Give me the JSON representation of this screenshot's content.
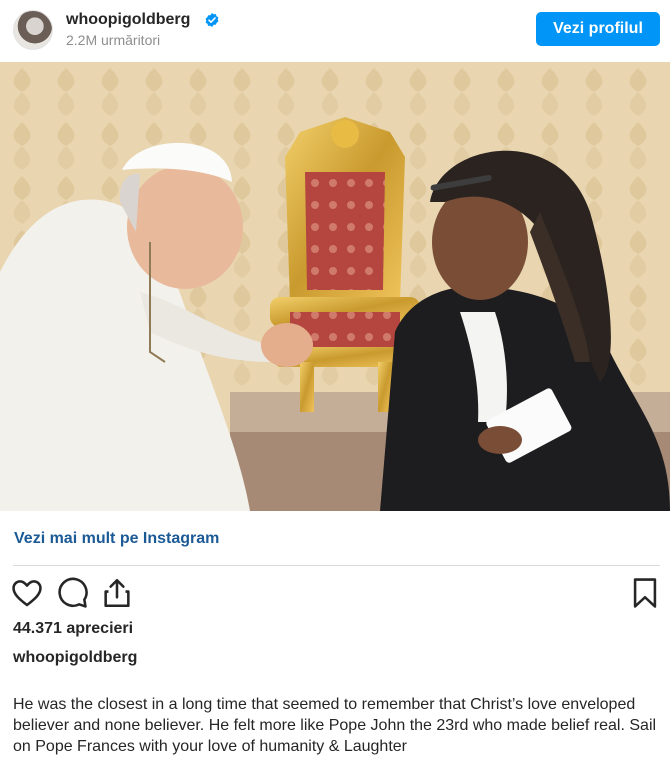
{
  "header": {
    "username": "whoopigoldberg",
    "followers": "2.2M urmăritori",
    "profile_button": "Vezi profilul",
    "verified_icon": "verified-badge-icon"
  },
  "colors": {
    "accent": "#0095f6",
    "link": "#1c5a96",
    "text": "#262626",
    "muted": "#8e8e8e"
  },
  "link": {
    "more_on_instagram": "Vezi mai mult pe Instagram"
  },
  "actions": {
    "icons": [
      "heart-icon",
      "comment-icon",
      "share-icon",
      "bookmark-icon"
    ]
  },
  "post": {
    "likes": "44.371 aprecieri",
    "caption_username": "whoopigoldberg",
    "caption_text": "He was the closest in a long time that seemed to remember that Christ’s love enveloped believer and none believer. He felt more like Pope John the 23rd who made belief real. Sail on Pope Frances with your love of humanity & Laughter"
  }
}
